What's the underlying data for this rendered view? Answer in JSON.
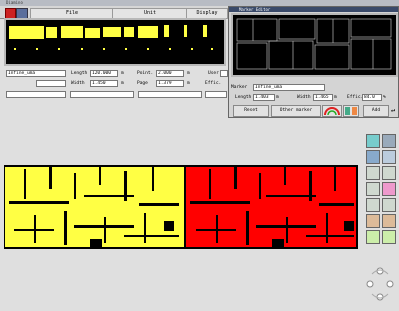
{
  "app": {
    "title": "Diamino"
  },
  "menu": {
    "file": "File",
    "unit": "Unit",
    "display": "Display"
  },
  "model_panel": {
    "name_field": "Infine_uma",
    "length_label": "Length",
    "length_value": "120.000",
    "length_unit": "m",
    "width_label": "Width",
    "width_value": "1.450",
    "width_unit": "m",
    "point_label": "Point.",
    "point_value": "2.000",
    "point_unit": "m",
    "page_label": "Page",
    "page_value": "1.379",
    "page_unit": "m",
    "user_label": "User",
    "effic_label": "Effic."
  },
  "marker_editor": {
    "title": "Marker Editor",
    "marker_label": "Marker",
    "marker_value": "Infine_uma",
    "length_label": "Length",
    "length_value": "1.403",
    "length_unit": "m",
    "width_label": "Width",
    "width_value": "1.465",
    "width_unit": "m",
    "effic_label": "Effic.",
    "effic_value": "84.0",
    "effic_unit": "%",
    "reset_button": "Reset",
    "other_marker_button": "Other marker",
    "add_button": "Add"
  },
  "colors": {
    "yellow": "#ffff44",
    "red": "#ff0000",
    "black": "#000000",
    "background": "#dfdfdf"
  }
}
